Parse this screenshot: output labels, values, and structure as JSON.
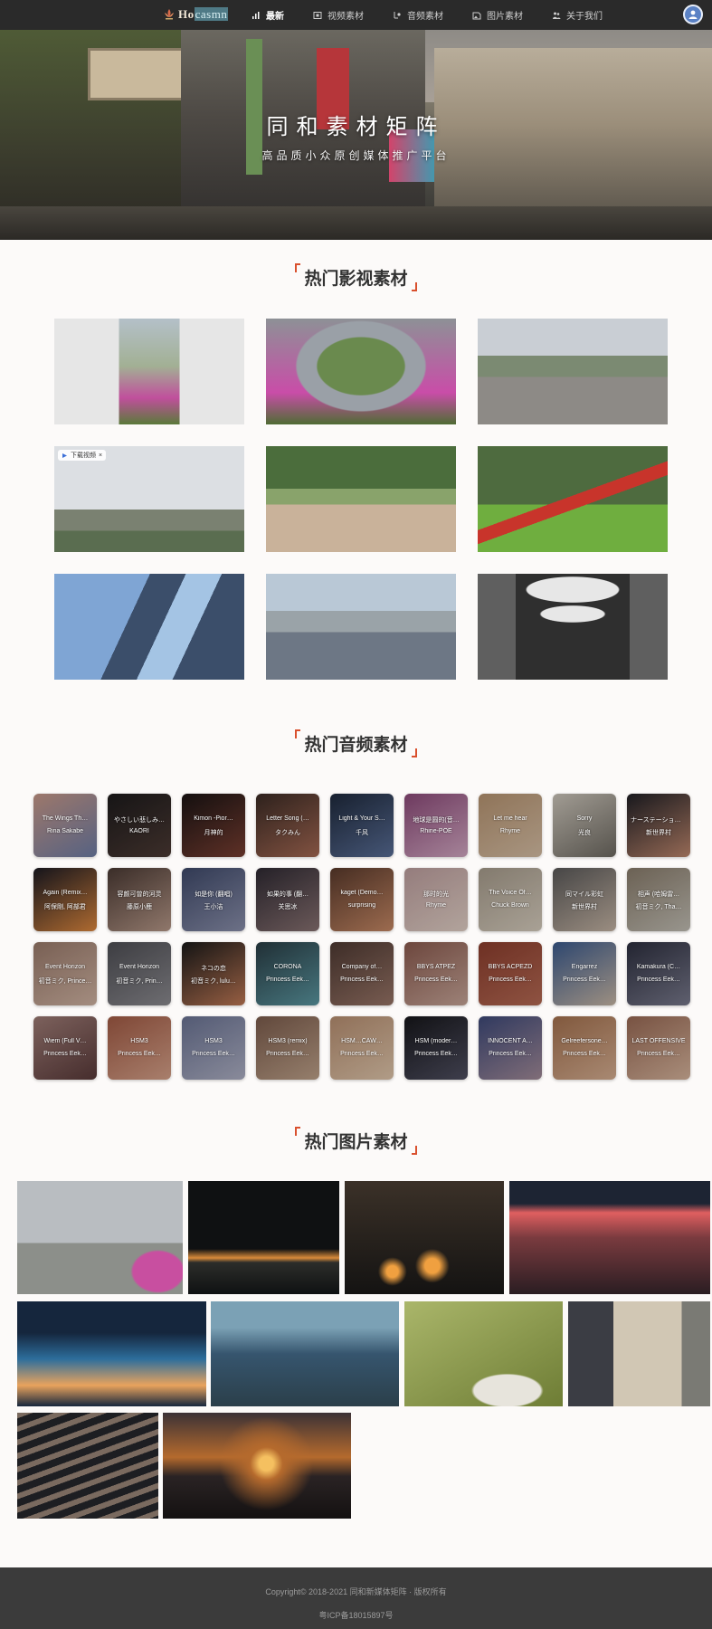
{
  "nav": {
    "logo_prefix": "Ho",
    "logo_highlight": "casmn",
    "items": [
      {
        "label": "最新",
        "icon": "lines-icon",
        "active": true
      },
      {
        "label": "视频素材",
        "icon": "video-icon",
        "active": false
      },
      {
        "label": "音频素材",
        "icon": "audio-icon",
        "active": false
      },
      {
        "label": "图片素材",
        "icon": "image-icon",
        "active": false
      },
      {
        "label": "关于我们",
        "icon": "people-icon",
        "active": false
      }
    ]
  },
  "hero": {
    "title": "同和素材矩阵",
    "subtitle": "高品质小众原创媒体推广平台"
  },
  "sections": {
    "video_title": "热门影视素材",
    "audio_title": "热门音频素材",
    "image_title": "热门图片素材"
  },
  "video_badge": "下载视频",
  "videos": [
    {
      "scene": "flowers-street",
      "colors": [
        "#e6e6e6",
        "#a2b094",
        "#c04f9c"
      ]
    },
    {
      "scene": "ring-flowers",
      "colors": [
        "#9aa0a7",
        "#6a8a4e",
        "#c94da8"
      ]
    },
    {
      "scene": "railway-city",
      "colors": [
        "#c9ced4",
        "#7b8a72",
        "#8d8a86"
      ]
    },
    {
      "scene": "power-lines",
      "colors": [
        "#dcdfe3",
        "#7a8171",
        "#5a6d50"
      ]
    },
    {
      "scene": "crowd-park",
      "colors": [
        "#4b6d3c",
        "#89a36b",
        "#c9b29a"
      ]
    },
    {
      "scene": "red-flag-lawn",
      "colors": [
        "#4e6b3f",
        "#6fae3f",
        "#c8342b"
      ]
    },
    {
      "scene": "glass-tower",
      "colors": [
        "#7fa5d4",
        "#a4c4e4",
        "#3b4e6a"
      ]
    },
    {
      "scene": "overpass",
      "colors": [
        "#b9c8d6",
        "#6d7785",
        "#9aa3a8"
      ]
    },
    {
      "scene": "tunnel",
      "colors": [
        "#2f2f2f",
        "#e7e7e7",
        "#5f5f5f"
      ]
    }
  ],
  "audios": [
    {
      "title": "The Wings Th…",
      "artist": "Rina Sakabe",
      "colors": [
        "#c99a8a",
        "#6f7ea7"
      ]
    },
    {
      "title": "やさしい悲しみ…",
      "artist": "KAORI",
      "colors": [
        "#1d1b1c",
        "#4d3b35"
      ]
    },
    {
      "title": "Kimon -Pior…",
      "artist": "月神的",
      "colors": [
        "#1a1414",
        "#7a3f32"
      ]
    },
    {
      "title": "Letter Song (…",
      "artist": "タクみん",
      "colors": [
        "#3b2b25",
        "#a76a54"
      ]
    },
    {
      "title": "Light & Your S…",
      "artist": "千风",
      "colors": [
        "#1f2a3d",
        "#5a6f98"
      ]
    },
    {
      "title": "地球是圆的(音…",
      "artist": "Rhine-POE",
      "colors": [
        "#8d4a7a",
        "#d4a9c4"
      ]
    },
    {
      "title": "Let me hear",
      "artist": "Rhyme",
      "colors": [
        "#b89572",
        "#d8c0a6"
      ]
    },
    {
      "title": "Sorry",
      "artist": "光良",
      "colors": [
        "#cfc8bd",
        "#6e6a62"
      ]
    },
    {
      "title": "ナーステーション…",
      "artist": "新世界村",
      "colors": [
        "#1f1f25",
        "#c0886e"
      ]
    },
    {
      "title": "Again (Remix…",
      "artist": "阿保剛, 阿部君",
      "colors": [
        "#1b1a23",
        "#e0893f"
      ]
    },
    {
      "title": "容颜可曾的河灵",
      "artist": "藤原小鹿",
      "colors": [
        "#4b3a34",
        "#b99a8a"
      ]
    },
    {
      "title": "如是你 (翻唱)",
      "artist": "王小洁",
      "colors": [
        "#3f4a6b",
        "#8c91ad"
      ]
    },
    {
      "title": "如果的事 (翻…",
      "artist": "关思冰",
      "colors": [
        "#2f2a33",
        "#8a7373"
      ]
    },
    {
      "title": "kaget (Demo…",
      "artist": "surprising",
      "colors": [
        "#5a3a2c",
        "#c98a66"
      ]
    },
    {
      "title": "那时的光",
      "artist": "Rhyme",
      "colors": [
        "#bfa0a0",
        "#e4d2c8"
      ]
    },
    {
      "title": "The Voice Of…",
      "artist": "Chuck Brown",
      "colors": [
        "#a89d8d",
        "#d9cfc0"
      ]
    },
    {
      "title": "同マイル彩虹",
      "artist": "新世界村",
      "colors": [
        "#5b5a5a",
        "#c7b6a6"
      ]
    },
    {
      "title": "相声 (哈姆雷…",
      "artist": "初音ミク, Tha…",
      "colors": [
        "#8a7d6c",
        "#c4c0b6"
      ]
    },
    {
      "title": "Event Horizon",
      "artist": "初音ミク, Prince…",
      "colors": [
        "#9b7b6c",
        "#d2b5a4"
      ]
    },
    {
      "title": "Event Horizon",
      "artist": "初音ミク, Prin…",
      "colors": [
        "#4f4f55",
        "#8d8c91"
      ]
    },
    {
      "title": "ネコの恋",
      "artist": "初音ミク, lulu…",
      "colors": [
        "#1a1a1a",
        "#c27a56"
      ]
    },
    {
      "title": "CORONA",
      "artist": "Princess Eek…",
      "colors": [
        "#2a3d45",
        "#5c99a3"
      ]
    },
    {
      "title": "Company of…",
      "artist": "Princess Eek…",
      "colors": [
        "#4f3a33",
        "#9a7668"
      ]
    },
    {
      "title": "BBYS ATPEZ",
      "artist": "Princess Eek…",
      "colors": [
        "#8c5b4f",
        "#c9a79a"
      ]
    },
    {
      "title": "BBYS ACPEZD",
      "artist": "Princess Eek…",
      "colors": [
        "#8d3e2e",
        "#b76b55"
      ]
    },
    {
      "title": "Engarrez",
      "artist": "Princess Eek…",
      "colors": [
        "#3b5b8f",
        "#c9b8a6"
      ]
    },
    {
      "title": "Kamakura (C…",
      "artist": "Princess Eek…",
      "colors": [
        "#2d2f3f",
        "#7a7b8e"
      ]
    },
    {
      "title": "Wiem (Full V…",
      "artist": "Princess Eek…",
      "colors": [
        "#a07d77",
        "#5a3a3a"
      ]
    },
    {
      "title": "HSM3",
      "artist": "Princess Eek…",
      "colors": [
        "#a35b45",
        "#d8a38b"
      ]
    },
    {
      "title": "HSM3",
      "artist": "Princess Eek…",
      "colors": [
        "#6b7495",
        "#b0b2c6"
      ]
    },
    {
      "title": "HSM3 (remix)",
      "artist": "Princess Eek…",
      "colors": [
        "#7d5d4d",
        "#c0a38b"
      ]
    },
    {
      "title": "HSM…CAW…",
      "artist": "Princess Eek…",
      "colors": [
        "#b99072",
        "#e2c8ad"
      ]
    },
    {
      "title": "HSM (moder…",
      "artist": "Princess Eek…",
      "colors": [
        "#17171b",
        "#505062"
      ]
    },
    {
      "title": "INNOCENT A…",
      "artist": "Princess Eek…",
      "colors": [
        "#3e4a7a",
        "#a48c9a"
      ]
    },
    {
      "title": "Gelreefersone…",
      "artist": "Princess Eek…",
      "colors": [
        "#a6724f",
        "#d8b093"
      ]
    },
    {
      "title": "LAST OFFENSIVE",
      "artist": "Princess Eek…",
      "colors": [
        "#9a6a55",
        "#d9b69e"
      ]
    }
  ],
  "photos": [
    {
      "scene": "flowers-city-haze",
      "colors": [
        "#b9bdc1",
        "#8c8f8a",
        "#c84fa0"
      ]
    },
    {
      "scene": "night-city-lights",
      "colors": [
        "#0f1112",
        "#2c2d2a",
        "#d88a3a"
      ]
    },
    {
      "scene": "candle-vigil",
      "colors": [
        "#141312",
        "#3b3128",
        "#f0a040"
      ]
    },
    {
      "scene": "city-sunset-red",
      "colors": [
        "#1d2433",
        "#7a3b3f",
        "#e05f60"
      ]
    },
    {
      "scene": "blue-skyline",
      "colors": [
        "#15263d",
        "#2d6e9c",
        "#e9a35d"
      ]
    },
    {
      "scene": "teal-skyline",
      "colors": [
        "#36556e",
        "#7ba1b5",
        "#2b3f4a"
      ]
    },
    {
      "scene": "swallows",
      "colors": [
        "#6e7d35",
        "#aab66a",
        "#e7e4dc"
      ]
    },
    {
      "scene": "old-building",
      "colors": [
        "#7a7a74",
        "#d1c7b4",
        "#3b3d44"
      ]
    },
    {
      "scene": "roof-tiles",
      "colors": [
        "#1d1e22",
        "#7a6a5f",
        "#4d5663"
      ]
    },
    {
      "scene": "sunset-sun",
      "colors": [
        "#2a2324",
        "#b56a2d",
        "#f5c060"
      ]
    }
  ],
  "footer": {
    "copyright": "Copyright© 2018-2021 同和新媒体矩阵 · 版权所有",
    "icp": "粤ICP备18015897号"
  }
}
